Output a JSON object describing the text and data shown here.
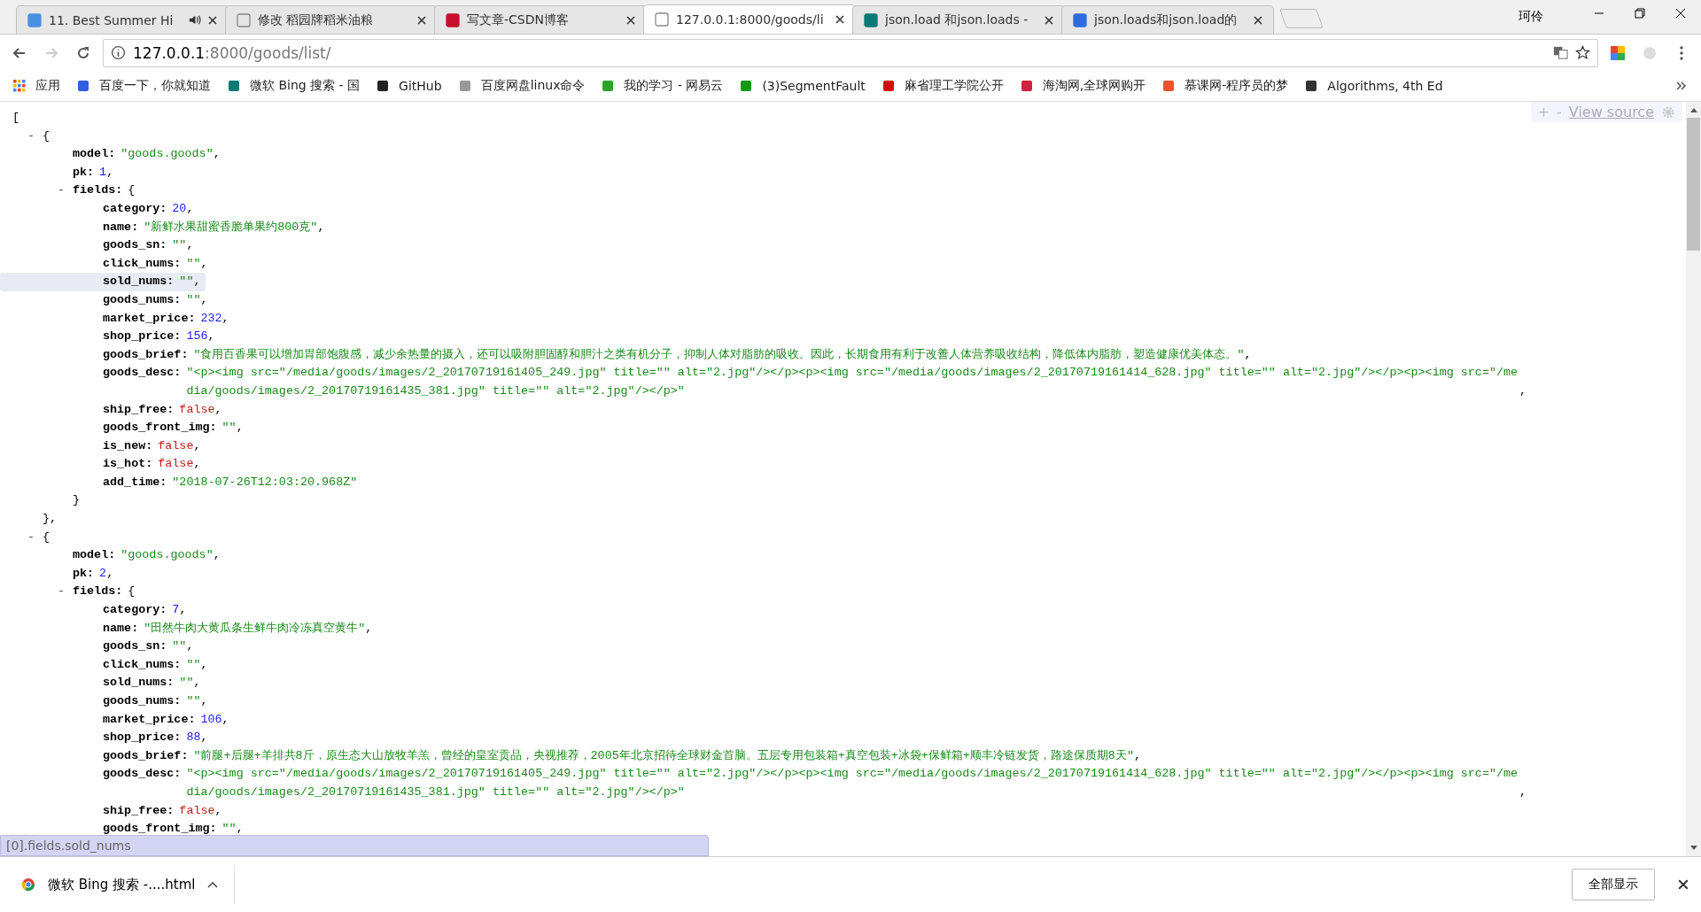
{
  "window": {
    "profile": "珂伶"
  },
  "tabs": [
    {
      "title": "11. Best Summer Hi",
      "selected": false,
      "audio": true
    },
    {
      "title": "修改 稻园牌稻米油粮",
      "selected": false,
      "audio": false
    },
    {
      "title": "写文章-CSDN博客",
      "selected": false,
      "audio": false
    },
    {
      "title": "127.0.0.1:8000/goods/li",
      "selected": true,
      "audio": false
    },
    {
      "title": "json.load 和json.loads -",
      "selected": false,
      "audio": false
    },
    {
      "title": "json.loads和json.load的",
      "selected": false,
      "audio": false
    }
  ],
  "toolbar": {
    "forward_disabled": true,
    "address": {
      "host": "127.0.0.1",
      "path": ":8000/goods/list/"
    }
  },
  "bookmarks": [
    "应用",
    "百度一下，你就知道",
    "微软 Bing 搜索 - 国",
    "GitHub",
    "百度网盘linux命令",
    "我的学习 - 网易云",
    "(3)SegmentFault",
    "麻省理工学院公开",
    "海淘网,全球网购开",
    "慕课网-程序员的梦",
    "Algorithms, 4th Ed"
  ],
  "viewer": {
    "zoom_in": "+",
    "zoom_out": "-",
    "view_source": "View source"
  },
  "json_tree": {
    "open": "[",
    "children": [
      {
        "toggle": "-",
        "open": "{",
        "close": "},",
        "children": [
          {
            "key": "model:",
            "value": "\"goods.goods\"",
            "kind": "string",
            "punct": ","
          },
          {
            "key": "pk:",
            "value": "1",
            "kind": "number",
            "punct": ","
          },
          {
            "key": "fields:",
            "toggle": "-",
            "open": "{",
            "close": "}",
            "children": [
              {
                "key": "category:",
                "value": "20",
                "kind": "number",
                "punct": ","
              },
              {
                "key": "name:",
                "value": "\"新鲜水果甜蜜香脆单果约800克\"",
                "kind": "string",
                "punct": ","
              },
              {
                "key": "goods_sn:",
                "value": "\"\"",
                "kind": "string",
                "punct": ","
              },
              {
                "key": "click_nums:",
                "value": "\"\"",
                "kind": "string",
                "punct": ","
              },
              {
                "key": "sold_nums:",
                "value": "\"\"",
                "kind": "string",
                "punct": ",",
                "hovered": true
              },
              {
                "key": "goods_nums:",
                "value": "\"\"",
                "kind": "string",
                "punct": ","
              },
              {
                "key": "market_price:",
                "value": "232",
                "kind": "number",
                "punct": ","
              },
              {
                "key": "shop_price:",
                "value": "156",
                "kind": "number",
                "punct": ","
              },
              {
                "key": "goods_brief:",
                "value": "\"食用百香果可以增加胃部饱腹感，减少余热量的摄入，还可以吸附胆固醇和胆汁之类有机分子，抑制人体对脂肪的吸收。因此，长期食用有利于改善人体营养吸收结构，降低体内脂肪，塑造健康优美体态。\"",
                "kind": "string",
                "punct": ","
              },
              {
                "key": "goods_desc:",
                "value": "\"<p><img src=\"/media/goods/images/2_20170719161405_249.jpg\" title=\"\" alt=\"2.jpg\"/></p><p><img src=\"/media/goods/images/2_20170719161414_628.jpg\" title=\"\" alt=\"2.jpg\"/></p><p><img src=\"/media/goods/images/2_20170719161435_381.jpg\" title=\"\" alt=\"2.jpg\"/></p>\"",
                "kind": "string",
                "punct": ","
              },
              {
                "key": "ship_free:",
                "value": "false",
                "kind": "bool",
                "punct": ","
              },
              {
                "key": "goods_front_img:",
                "value": "\"\"",
                "kind": "string",
                "punct": ","
              },
              {
                "key": "is_new:",
                "value": "false",
                "kind": "bool",
                "punct": ","
              },
              {
                "key": "is_hot:",
                "value": "false",
                "kind": "bool",
                "punct": ","
              },
              {
                "key": "add_time:",
                "value": "\"2018-07-26T12:03:20.968Z\"",
                "kind": "string"
              }
            ]
          }
        ]
      },
      {
        "toggle": "-",
        "open": "{",
        "children": [
          {
            "key": "model:",
            "value": "\"goods.goods\"",
            "kind": "string",
            "punct": ","
          },
          {
            "key": "pk:",
            "value": "2",
            "kind": "number",
            "punct": ","
          },
          {
            "key": "fields:",
            "toggle": "-",
            "open": "{",
            "children": [
              {
                "key": "category:",
                "value": "7",
                "kind": "number",
                "punct": ","
              },
              {
                "key": "name:",
                "value": "\"田然牛肉大黄瓜条生鲜牛肉冷冻真空黄牛\"",
                "kind": "string",
                "punct": ","
              },
              {
                "key": "goods_sn:",
                "value": "\"\"",
                "kind": "string",
                "punct": ","
              },
              {
                "key": "click_nums:",
                "value": "\"\"",
                "kind": "string",
                "punct": ","
              },
              {
                "key": "sold_nums:",
                "value": "\"\"",
                "kind": "string",
                "punct": ","
              },
              {
                "key": "goods_nums:",
                "value": "\"\"",
                "kind": "string",
                "punct": ","
              },
              {
                "key": "market_price:",
                "value": "106",
                "kind": "number",
                "punct": ","
              },
              {
                "key": "shop_price:",
                "value": "88",
                "kind": "number",
                "punct": ","
              },
              {
                "key": "goods_brief:",
                "value": "\"前腿+后腿+羊排共8斤，原生态大山放牧羊羔，曾经的皇室贡品，央视推荐，2005年北京招待全球财金首脑。五层专用包装箱+真空包装+冰袋+保鲜箱+顺丰冷链发货，路途保质期8天\"",
                "kind": "string",
                "punct": ","
              },
              {
                "key": "goods_desc:",
                "value": "\"<p><img src=\"/media/goods/images/2_20170719161405_249.jpg\" title=\"\" alt=\"2.jpg\"/></p><p><img src=\"/media/goods/images/2_20170719161414_628.jpg\" title=\"\" alt=\"2.jpg\"/></p><p><img src=\"/media/goods/images/2_20170719161435_381.jpg\" title=\"\" alt=\"2.jpg\"/></p>\"",
                "kind": "string",
                "punct": ","
              },
              {
                "key": "ship_free:",
                "value": "false",
                "kind": "bool",
                "punct": ","
              },
              {
                "key": "goods_front_img:",
                "value": "\"\"",
                "kind": "string",
                "punct": ","
              }
            ]
          }
        ]
      }
    ]
  },
  "status_path": "[0].fields.sold_nums",
  "download_bar": {
    "file": "微软 Bing 搜索 -....html",
    "show_all": "全部显示"
  }
}
